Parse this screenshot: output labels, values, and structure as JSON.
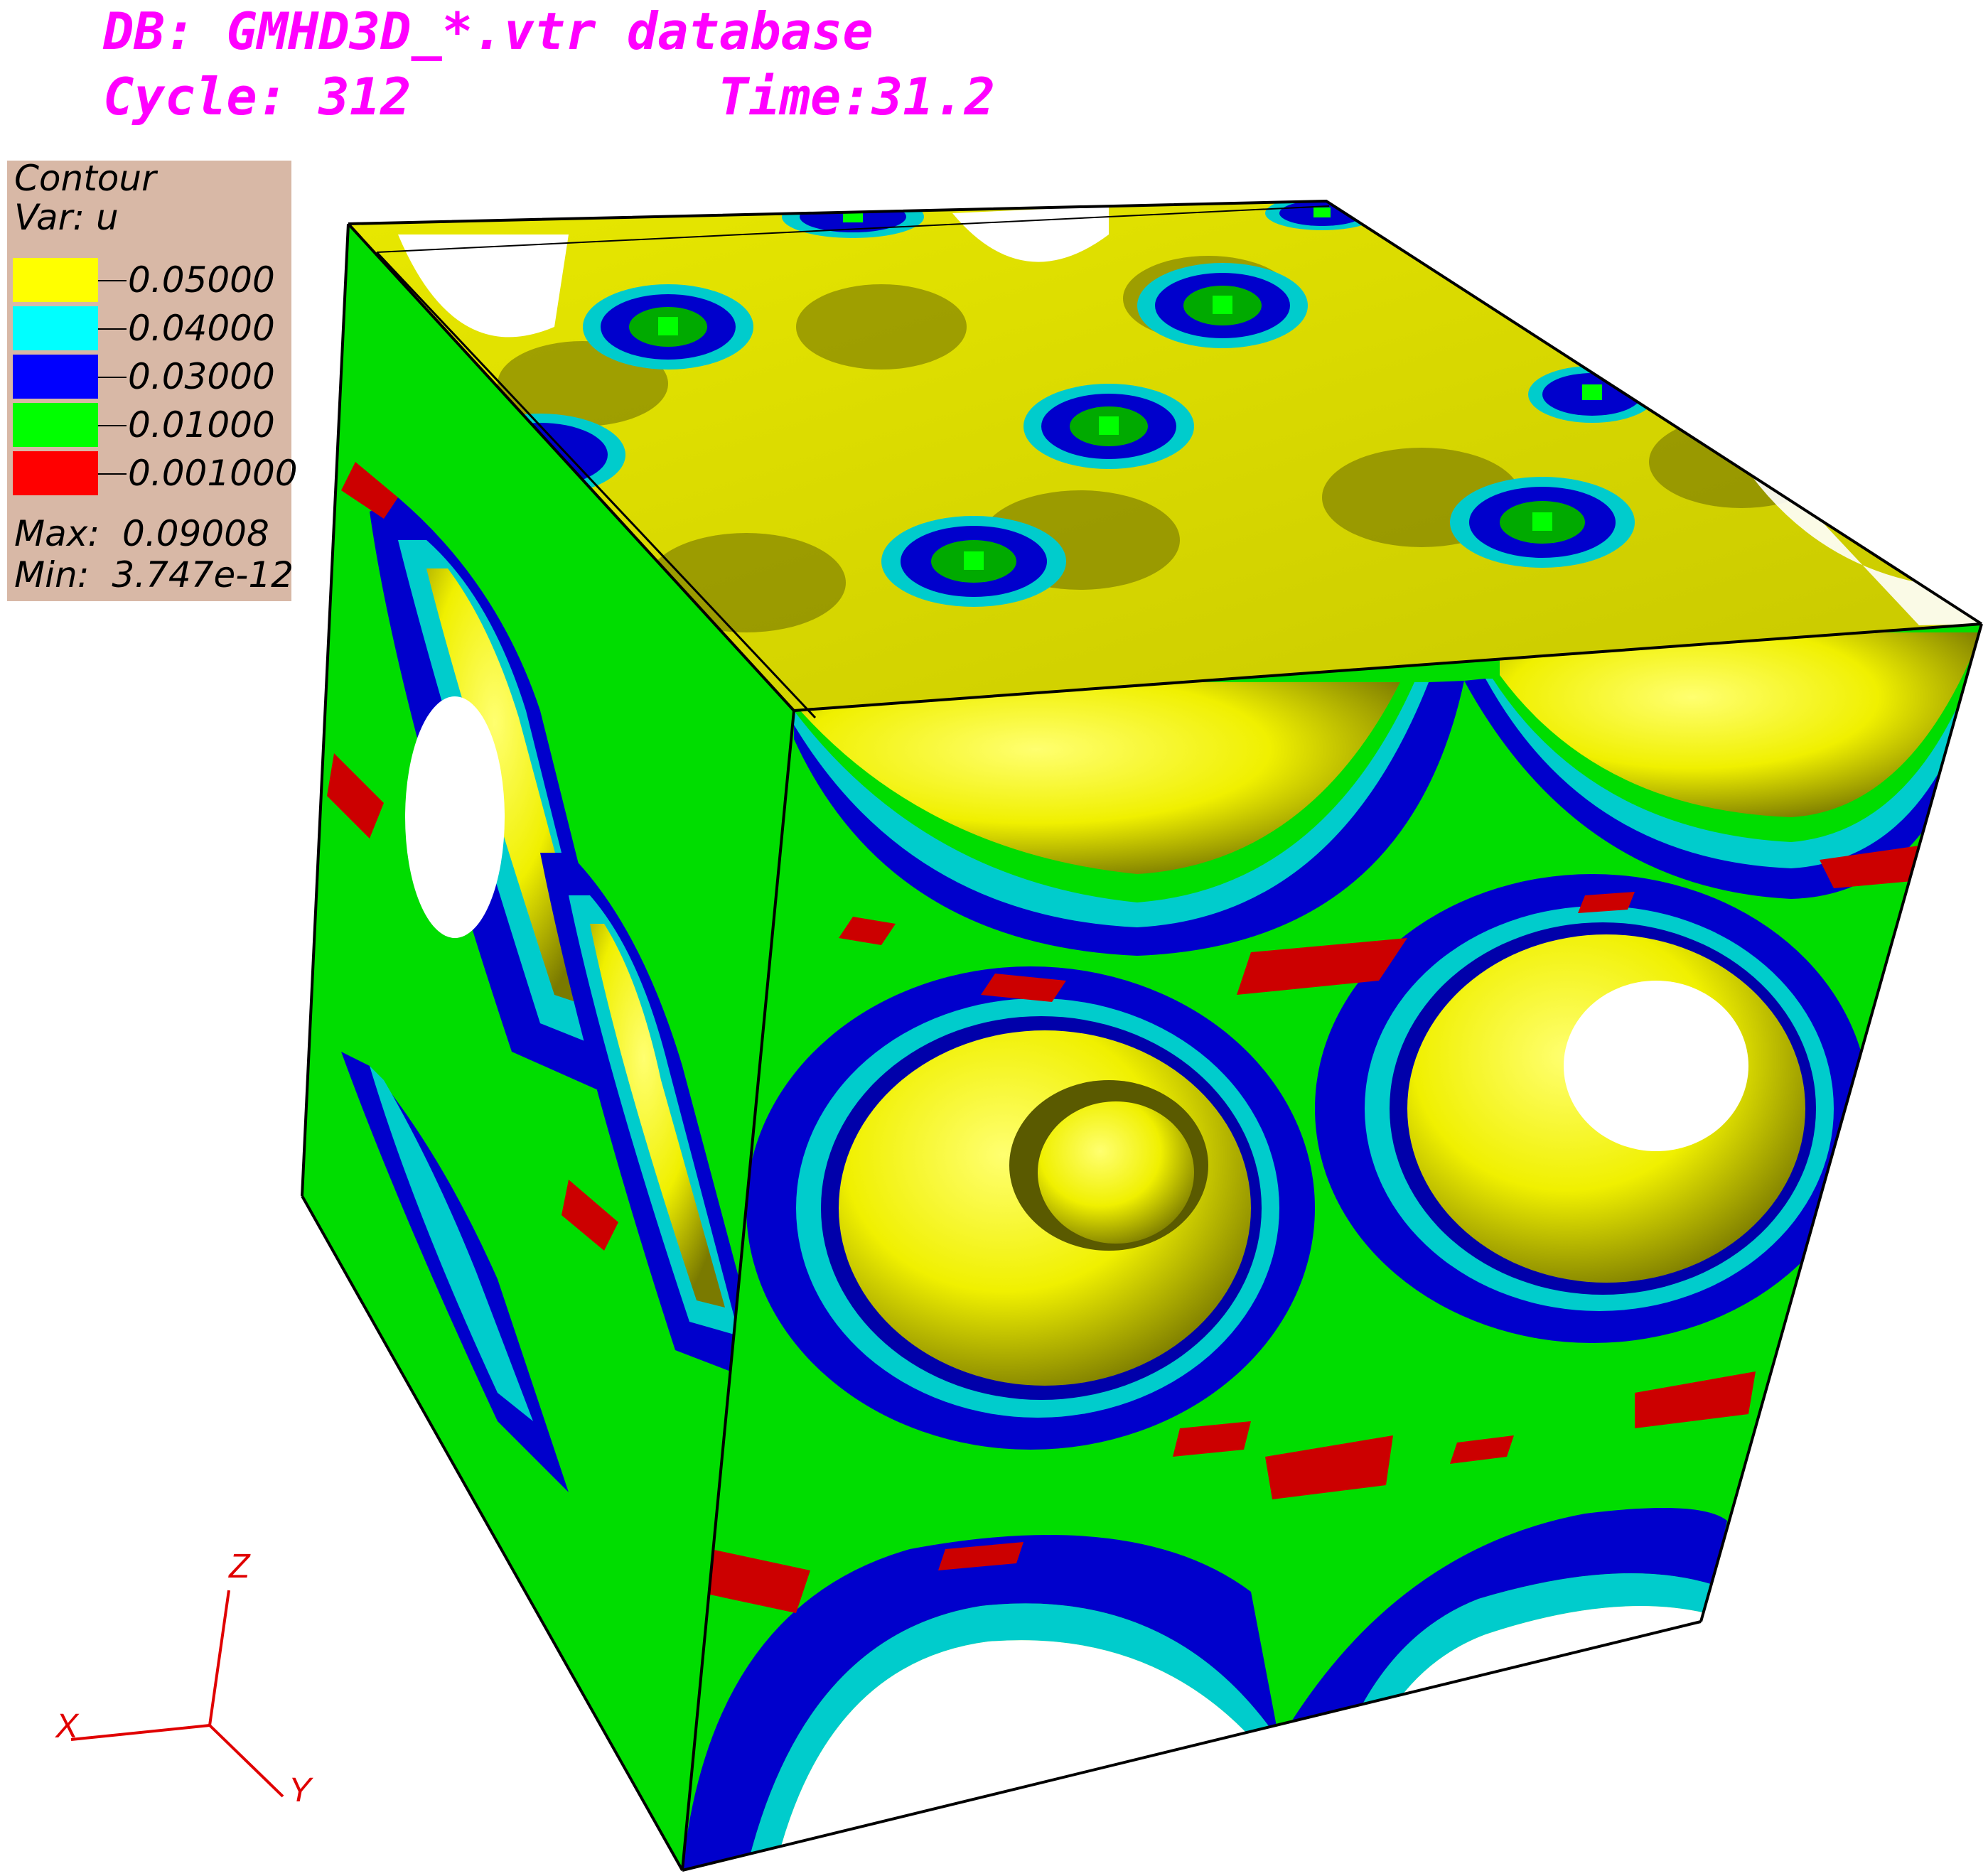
{
  "header": {
    "db_line": "DB: GMHD3D_*.vtr database",
    "cycle_label": "Cycle: 312",
    "time_label": "Time:31.2"
  },
  "legend": {
    "title": "Contour",
    "var": "Var: u",
    "levels": [
      {
        "color": "#ffff00",
        "value": "0.05000"
      },
      {
        "color": "#00ffff",
        "value": "0.04000"
      },
      {
        "color": "#0000ff",
        "value": "0.03000"
      },
      {
        "color": "#00ff00",
        "value": "0.01000"
      },
      {
        "color": "#ff0000",
        "value": "0.001000"
      }
    ],
    "max_label": "Max:",
    "max_value": "0.09008",
    "min_label": "Min:",
    "min_value": "3.747e-12"
  },
  "axes": {
    "x": "X",
    "y": "Y",
    "z": "Z",
    "color": "#ff0000"
  }
}
